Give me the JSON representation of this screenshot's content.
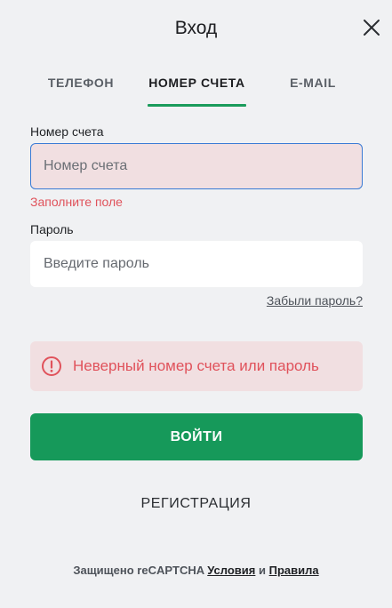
{
  "dialog": {
    "title": "Вход"
  },
  "tabs": [
    {
      "label": "ТЕЛЕФОН",
      "active": false
    },
    {
      "label": "НОМЕР СЧЕТА",
      "active": true
    },
    {
      "label": "E-MAIL",
      "active": false
    }
  ],
  "account_field": {
    "label": "Номер счета",
    "placeholder": "Номер счета",
    "value": "",
    "error": "Заполните поле"
  },
  "password_field": {
    "label": "Пароль",
    "placeholder": "Введите пароль",
    "value": ""
  },
  "forgot_password": "Забыли пароль?",
  "alert": {
    "message": "Неверный номер счета или пароль"
  },
  "login_button": "ВОЙТИ",
  "register_link": "РЕГИСТРАЦИЯ",
  "footer": {
    "text": "Защищено reCAPTCHA",
    "terms": "Условия",
    "and": "и",
    "rules": "Правила"
  },
  "colors": {
    "accent": "#16995a",
    "error": "#e0525b",
    "error_bg": "#f1dfe1",
    "focus_border": "#3a7bd5"
  }
}
